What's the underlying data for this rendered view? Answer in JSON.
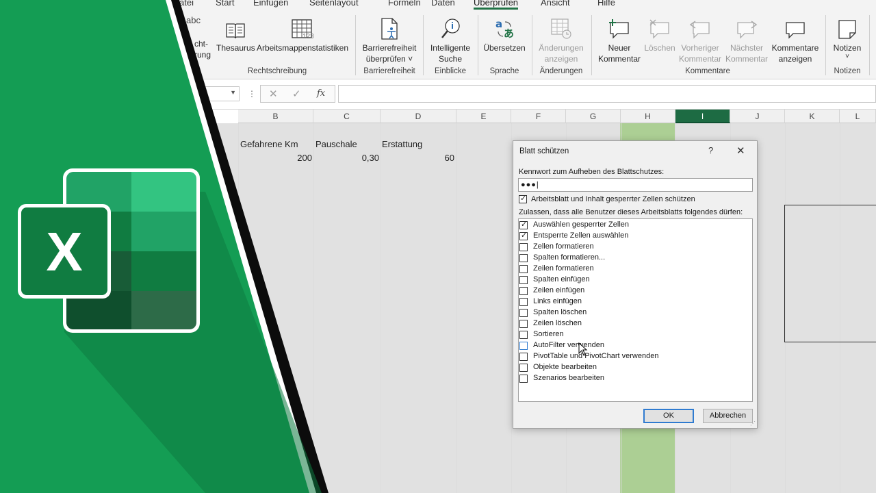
{
  "ribbon": {
    "tabs": [
      "atei",
      "Start",
      "Einfügen",
      "Seitenlayout",
      "Formeln",
      "Daten",
      "Überprüfen",
      "Ansicht",
      "Hilfe"
    ],
    "active_tab": "Überprüfen",
    "partial_abc": "abc",
    "partial_label": "cht-\nrung",
    "buttons": {
      "thesaurus": "Thesaurus",
      "stats": "Arbeitsmappenstatistiken",
      "accessibility_l1": "Barrierefreiheit",
      "accessibility_l2": "überprüfen ˅",
      "smart_l1": "Intelligente",
      "smart_l2": "Suche",
      "translate": "Übersetzen",
      "changes_l1": "Änderungen",
      "changes_l2": "anzeigen",
      "new_comment_l1": "Neuer",
      "new_comment_l2": "Kommentar",
      "delete": "Löschen",
      "prev_l1": "Vorheriger",
      "prev_l2": "Kommentar",
      "next_l1": "Nächster",
      "next_l2": "Kommentar",
      "show_comments_l1": "Kommentare",
      "show_comments_l2": "anzeigen",
      "notes": "Notizen",
      "notes_caret": "˅"
    },
    "groups": {
      "proofing": "Rechtschreibung",
      "accessibility": "Barrierefreiheit",
      "insights": "Einblicke",
      "language": "Sprache",
      "changes": "Änderungen",
      "comments": "Kommentare",
      "notes": "Notizen"
    }
  },
  "formula_bar": {
    "dots": "⋮",
    "cancel": "✕",
    "enter": "✓",
    "fx": "fx",
    "namebox_arrow": "▼"
  },
  "columns": [
    "B",
    "C",
    "D",
    "E",
    "F",
    "G",
    "H",
    "I",
    "J",
    "K",
    "L"
  ],
  "selected_column": "I",
  "highlight_column": "H",
  "cells": {
    "b2": "Gefahrene Km",
    "c2": "Pauschale",
    "d2": "Erstattung",
    "b3": "200",
    "c3": "0,30",
    "d3": "60"
  },
  "dialog": {
    "title": "Blatt schützen",
    "help": "?",
    "close": "✕",
    "password_label": "Kennwort zum Aufheben des Blattschutzes:",
    "password_value": "●●●|",
    "protect_label": "Arbeitsblatt und Inhalt gesperrter Zellen schützen",
    "protect_checked": true,
    "allow_label": "Zulassen, dass alle Benutzer dieses Arbeitsblatts folgendes dürfen:",
    "options": [
      {
        "label": "Auswählen gesperrter Zellen",
        "checked": true
      },
      {
        "label": "Entsperrte Zellen auswählen",
        "checked": true
      },
      {
        "label": "Zellen formatieren",
        "checked": false
      },
      {
        "label": "Spalten formatieren...",
        "checked": false
      },
      {
        "label": "Zeilen formatieren",
        "checked": false
      },
      {
        "label": "Spalten einfügen",
        "checked": false
      },
      {
        "label": "Zeilen einfügen",
        "checked": false
      },
      {
        "label": "Links einfügen",
        "checked": false
      },
      {
        "label": "Spalten löschen",
        "checked": false
      },
      {
        "label": "Zeilen löschen",
        "checked": false
      },
      {
        "label": "Sortieren",
        "checked": false
      },
      {
        "label": "AutoFilter verwenden",
        "checked": false
      },
      {
        "label": "PivotTable und PivotChart verwenden",
        "checked": false
      },
      {
        "label": "Objekte bearbeiten",
        "checked": false
      },
      {
        "label": "Szenarios bearbeiten",
        "checked": false
      }
    ],
    "ok": "OK",
    "cancel": "Abbrechen"
  },
  "logo": {
    "letter": "X"
  },
  "colors": {
    "excel_green": "#107c41",
    "panel_green": "#149d54",
    "highlight_column": "#a9cd8f",
    "selected_header": "#1d6b43"
  },
  "icons": [
    "thesaurus-icon",
    "stats-icon",
    "accessibility-icon",
    "smart-lookup-icon",
    "translate-icon",
    "changes-icon",
    "new-comment-icon",
    "delete-comment-icon",
    "prev-comment-icon",
    "next-comment-icon",
    "show-comments-icon",
    "notes-icon",
    "excel-logo-icon",
    "cursor-icon"
  ]
}
